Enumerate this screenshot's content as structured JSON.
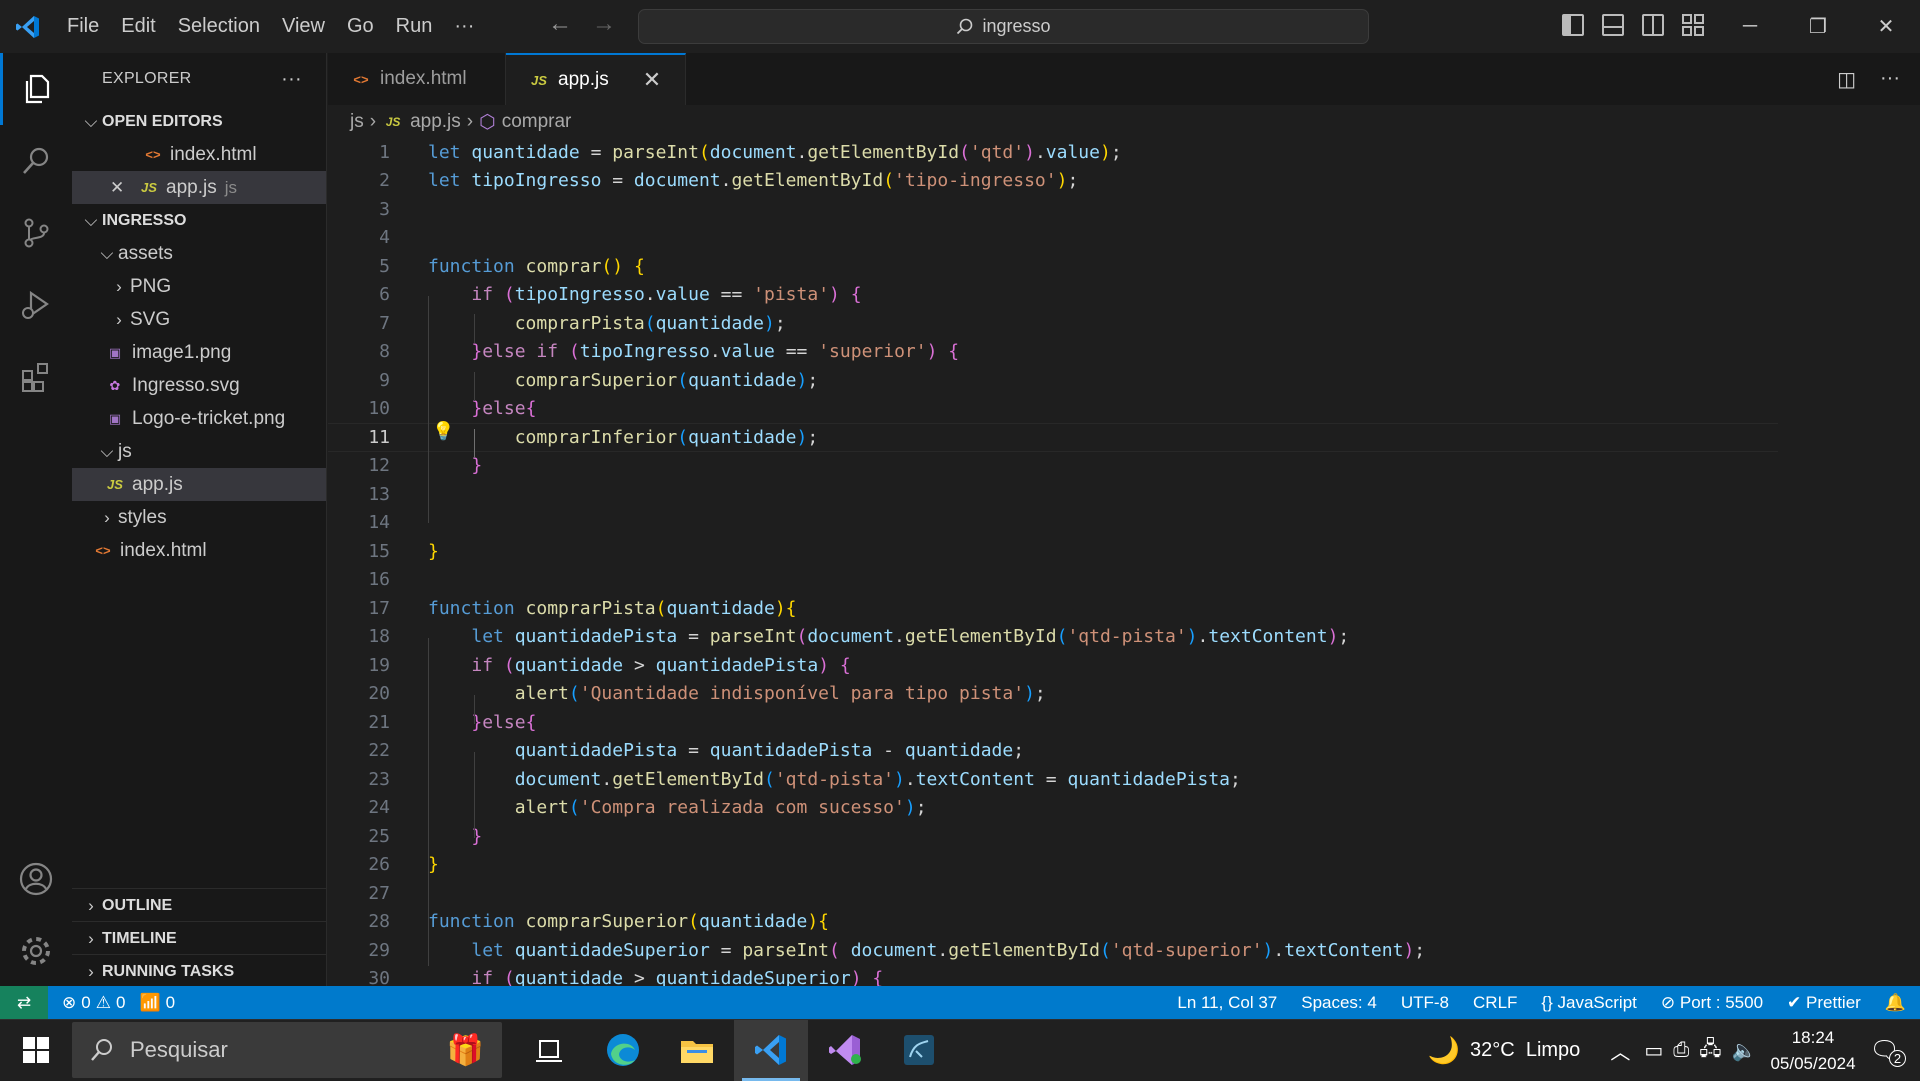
{
  "titlebar": {
    "menu": [
      "File",
      "Edit",
      "Selection",
      "View",
      "Go",
      "Run",
      "···"
    ],
    "search": "ingresso"
  },
  "sidebar": {
    "title": "EXPLORER",
    "more": "···",
    "open_editors_label": "OPEN EDITORS",
    "open_editors": [
      {
        "name": "index.html",
        "icon": "html",
        "close": "",
        "extra": ""
      },
      {
        "name": "app.js",
        "icon": "js",
        "close": "✕",
        "extra": "js"
      }
    ],
    "project_label": "INGRESSO",
    "tree": {
      "assets": "assets",
      "png": "PNG",
      "svg": "SVG",
      "image1": "image1.png",
      "ingresso_svg": "Ingresso.svg",
      "logo": "Logo-e-tricket.png",
      "js": "js",
      "appjs": "app.js",
      "styles": "styles",
      "index": "index.html"
    },
    "outline": "OUTLINE",
    "timeline": "TIMELINE",
    "running_tasks": "RUNNING TASKS"
  },
  "tabs": [
    {
      "label": "index.html",
      "icon": "<>"
    },
    {
      "label": "app.js",
      "icon": "JS",
      "close": "✕"
    }
  ],
  "breadcrumb": {
    "folder": "js",
    "file": "app.js",
    "symbol": "comprar"
  },
  "editor": {
    "current_line": 11,
    "lines": [
      [
        [
          "kw",
          "let"
        ],
        [
          "pl",
          " "
        ],
        [
          "var",
          "quantidade"
        ],
        [
          "pl",
          " = "
        ],
        [
          "fn",
          "parseInt"
        ],
        [
          "b1",
          "("
        ],
        [
          "var",
          "document"
        ],
        [
          "pl",
          "."
        ],
        [
          "fn",
          "getElementById"
        ],
        [
          "b2",
          "("
        ],
        [
          "str",
          "'qtd'"
        ],
        [
          "b2",
          ")"
        ],
        [
          "pl",
          "."
        ],
        [
          "var",
          "value"
        ],
        [
          "b1",
          ")"
        ],
        [
          "pl",
          ";"
        ]
      ],
      [
        [
          "kw",
          "let"
        ],
        [
          "pl",
          " "
        ],
        [
          "var",
          "tipoIngresso"
        ],
        [
          "pl",
          " = "
        ],
        [
          "var",
          "document"
        ],
        [
          "pl",
          "."
        ],
        [
          "fn",
          "getElementById"
        ],
        [
          "b1",
          "("
        ],
        [
          "str",
          "'tipo-ingresso'"
        ],
        [
          "b1",
          ")"
        ],
        [
          "pl",
          ";"
        ]
      ],
      [],
      [],
      [
        [
          "kw",
          "function"
        ],
        [
          "pl",
          " "
        ],
        [
          "fn",
          "comprar"
        ],
        [
          "b1",
          "()"
        ],
        [
          "pl",
          " "
        ],
        [
          "b1",
          "{"
        ]
      ],
      [
        [
          "pl",
          "    "
        ],
        [
          "ctl",
          "if"
        ],
        [
          "pl",
          " "
        ],
        [
          "b2",
          "("
        ],
        [
          "var",
          "tipoIngresso"
        ],
        [
          "pl",
          "."
        ],
        [
          "var",
          "value"
        ],
        [
          "pl",
          " == "
        ],
        [
          "str",
          "'pista'"
        ],
        [
          "b2",
          ")"
        ],
        [
          "pl",
          " "
        ],
        [
          "b2",
          "{"
        ]
      ],
      [
        [
          "pl",
          "        "
        ],
        [
          "fn",
          "comprarPista"
        ],
        [
          "b3",
          "("
        ],
        [
          "var",
          "quantidade"
        ],
        [
          "b3",
          ")"
        ],
        [
          "pl",
          ";"
        ]
      ],
      [
        [
          "pl",
          "    "
        ],
        [
          "b2",
          "}"
        ],
        [
          "ctl",
          "else"
        ],
        [
          "pl",
          " "
        ],
        [
          "ctl",
          "if"
        ],
        [
          "pl",
          " "
        ],
        [
          "b2",
          "("
        ],
        [
          "var",
          "tipoIngresso"
        ],
        [
          "pl",
          "."
        ],
        [
          "var",
          "value"
        ],
        [
          "pl",
          " == "
        ],
        [
          "str",
          "'superior'"
        ],
        [
          "b2",
          ")"
        ],
        [
          "pl",
          " "
        ],
        [
          "b2",
          "{"
        ]
      ],
      [
        [
          "pl",
          "        "
        ],
        [
          "fn",
          "comprarSuperior"
        ],
        [
          "b3",
          "("
        ],
        [
          "var",
          "quantidade"
        ],
        [
          "b3",
          ")"
        ],
        [
          "pl",
          ";"
        ]
      ],
      [
        [
          "pl",
          "    "
        ],
        [
          "b2",
          "}"
        ],
        [
          "ctl",
          "else"
        ],
        [
          "b2",
          "{"
        ]
      ],
      [
        [
          "pl",
          "        "
        ],
        [
          "fn",
          "comprarInferior"
        ],
        [
          "b3",
          "("
        ],
        [
          "var",
          "quantidade"
        ],
        [
          "b3",
          ")"
        ],
        [
          "pl",
          ";"
        ]
      ],
      [
        [
          "pl",
          "    "
        ],
        [
          "b2",
          "}"
        ]
      ],
      [],
      [],
      [
        [
          "b1",
          "}"
        ]
      ],
      [],
      [
        [
          "kw",
          "function"
        ],
        [
          "pl",
          " "
        ],
        [
          "fn",
          "comprarPista"
        ],
        [
          "b1",
          "("
        ],
        [
          "var",
          "quantidade"
        ],
        [
          "b1",
          ")"
        ],
        [
          "b1",
          "{"
        ]
      ],
      [
        [
          "pl",
          "    "
        ],
        [
          "kw",
          "let"
        ],
        [
          "pl",
          " "
        ],
        [
          "var",
          "quantidadePista"
        ],
        [
          "pl",
          " = "
        ],
        [
          "fn",
          "parseInt"
        ],
        [
          "b2",
          "("
        ],
        [
          "var",
          "document"
        ],
        [
          "pl",
          "."
        ],
        [
          "fn",
          "getElementById"
        ],
        [
          "b3",
          "("
        ],
        [
          "str",
          "'qtd-pista'"
        ],
        [
          "b3",
          ")"
        ],
        [
          "pl",
          "."
        ],
        [
          "var",
          "textContent"
        ],
        [
          "b2",
          ")"
        ],
        [
          "pl",
          ";"
        ]
      ],
      [
        [
          "pl",
          "    "
        ],
        [
          "ctl",
          "if"
        ],
        [
          "pl",
          " "
        ],
        [
          "b2",
          "("
        ],
        [
          "var",
          "quantidade"
        ],
        [
          "pl",
          " > "
        ],
        [
          "var",
          "quantidadePista"
        ],
        [
          "b2",
          ")"
        ],
        [
          "pl",
          " "
        ],
        [
          "b2",
          "{"
        ]
      ],
      [
        [
          "pl",
          "        "
        ],
        [
          "fn",
          "alert"
        ],
        [
          "b3",
          "("
        ],
        [
          "str",
          "'Quantidade indisponível para tipo pista'"
        ],
        [
          "b3",
          ")"
        ],
        [
          "pl",
          ";"
        ]
      ],
      [
        [
          "pl",
          "    "
        ],
        [
          "b2",
          "}"
        ],
        [
          "ctl",
          "else"
        ],
        [
          "b2",
          "{"
        ]
      ],
      [
        [
          "pl",
          "        "
        ],
        [
          "var",
          "quantidadePista"
        ],
        [
          "pl",
          " = "
        ],
        [
          "var",
          "quantidadePista"
        ],
        [
          "pl",
          " - "
        ],
        [
          "var",
          "quantidade"
        ],
        [
          "pl",
          ";"
        ]
      ],
      [
        [
          "pl",
          "        "
        ],
        [
          "var",
          "document"
        ],
        [
          "pl",
          "."
        ],
        [
          "fn",
          "getElementById"
        ],
        [
          "b3",
          "("
        ],
        [
          "str",
          "'qtd-pista'"
        ],
        [
          "b3",
          ")"
        ],
        [
          "pl",
          "."
        ],
        [
          "var",
          "textContent"
        ],
        [
          "pl",
          " = "
        ],
        [
          "var",
          "quantidadePista"
        ],
        [
          "pl",
          ";"
        ]
      ],
      [
        [
          "pl",
          "        "
        ],
        [
          "fn",
          "alert"
        ],
        [
          "b3",
          "("
        ],
        [
          "str",
          "'Compra realizada com sucesso'"
        ],
        [
          "b3",
          ")"
        ],
        [
          "pl",
          ";"
        ]
      ],
      [
        [
          "pl",
          "    "
        ],
        [
          "b2",
          "}"
        ]
      ],
      [
        [
          "b1",
          "}"
        ]
      ],
      [],
      [
        [
          "kw",
          "function"
        ],
        [
          "pl",
          " "
        ],
        [
          "fn",
          "comprarSuperior"
        ],
        [
          "b1",
          "("
        ],
        [
          "var",
          "quantidade"
        ],
        [
          "b1",
          ")"
        ],
        [
          "b1",
          "{"
        ]
      ],
      [
        [
          "pl",
          "    "
        ],
        [
          "kw",
          "let"
        ],
        [
          "pl",
          " "
        ],
        [
          "var",
          "quantidadeSuperior"
        ],
        [
          "pl",
          " = "
        ],
        [
          "fn",
          "parseInt"
        ],
        [
          "b2",
          "("
        ],
        [
          "pl",
          " "
        ],
        [
          "var",
          "document"
        ],
        [
          "pl",
          "."
        ],
        [
          "fn",
          "getElementById"
        ],
        [
          "b3",
          "("
        ],
        [
          "str",
          "'qtd-superior'"
        ],
        [
          "b3",
          ")"
        ],
        [
          "pl",
          "."
        ],
        [
          "var",
          "textContent"
        ],
        [
          "b2",
          ")"
        ],
        [
          "pl",
          ";"
        ]
      ],
      [
        [
          "pl",
          "    "
        ],
        [
          "ctl",
          "if"
        ],
        [
          "pl",
          " "
        ],
        [
          "b2",
          "("
        ],
        [
          "var",
          "quantidade"
        ],
        [
          "pl",
          " > "
        ],
        [
          "var",
          "quantidadeSuperior"
        ],
        [
          "b2",
          ")"
        ],
        [
          "pl",
          " "
        ],
        [
          "b2",
          "{"
        ]
      ]
    ]
  },
  "statusbar": {
    "errors": "0",
    "warnings": "0",
    "ports": "0",
    "position": "Ln 11, Col 37",
    "spaces": "Spaces: 4",
    "encoding": "UTF-8",
    "eol": "CRLF",
    "language": "JavaScript",
    "port": "Port : 5500",
    "prettier": "Prettier"
  },
  "taskbar": {
    "search": "Pesquisar",
    "weather": "32°C  Limpo",
    "time": "18:24",
    "date": "05/05/2024",
    "notifications": "2"
  },
  "colors": {
    "accent": "#007acc",
    "activity": "#0078d4",
    "remote": "#16825d"
  }
}
